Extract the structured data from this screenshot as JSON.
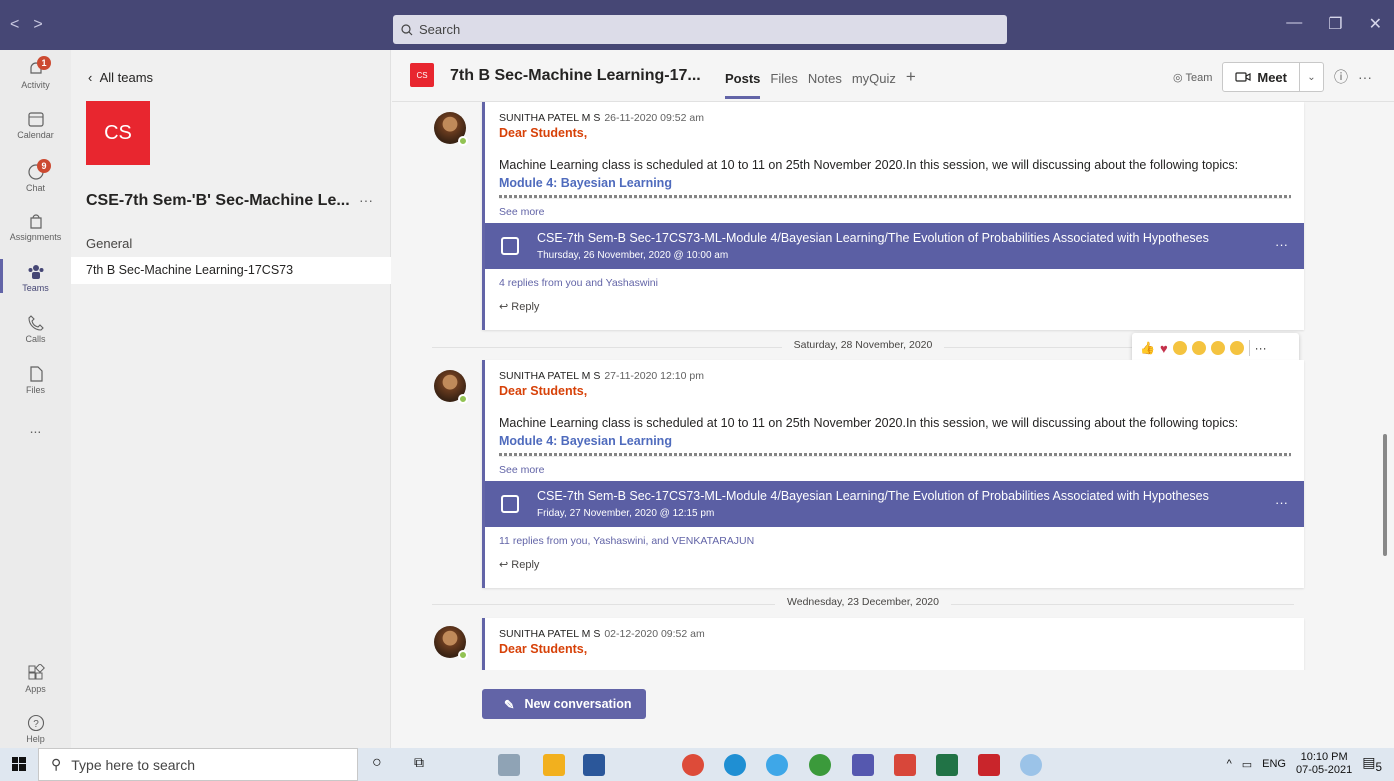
{
  "topbar": {
    "search_placeholder": "Search",
    "nav_back": "<",
    "nav_forward": ">",
    "minimize": "—",
    "maximize": "❐",
    "close": "✕"
  },
  "rail": {
    "items": [
      {
        "label": "Activity",
        "badge": "1"
      },
      {
        "label": "Calendar"
      },
      {
        "label": "Chat",
        "badge": "9"
      },
      {
        "label": "Assignments"
      },
      {
        "label": "Teams"
      },
      {
        "label": "Calls"
      },
      {
        "label": "Files"
      },
      {
        "label": "..."
      },
      {
        "label": "Apps"
      },
      {
        "label": "Help"
      }
    ]
  },
  "panel": {
    "back_label": "All teams",
    "team_logo": "CS",
    "team_name": "CSE-7th Sem-'B' Sec-Machine Le...",
    "more": "···",
    "channels": [
      "General",
      "7th B Sec-Machine Learning-17CS73"
    ]
  },
  "channel": {
    "logo": "CS",
    "title": "7th B Sec-Machine Learning-17...",
    "tabs": [
      "Posts",
      "Files",
      "Notes",
      "myQuiz",
      "+"
    ],
    "team_button": "Team",
    "meet_label": "Meet",
    "info": "ⓘ",
    "more": "···"
  },
  "posts": [
    {
      "author": "SUNITHA PATEL M S",
      "time": "26-11-2020 09:52 am",
      "greeting": "Dear Students,",
      "body": "Machine Learning class is scheduled at 10 to 11 on 25th November 2020.In this  session, we will discussing about the following topics:",
      "module": "Module 4:  Bayesian Learning",
      "see_more": "See more",
      "meeting_title": "CSE-7th Sem-B Sec-17CS73-ML-Module 4/Bayesian Learning/The Evolution of Probabilities Associated with Hypotheses",
      "meeting_date": "Thursday, 26 November, 2020 @ 10:00 am",
      "replies": "4 replies from you and Yashaswini",
      "reply_label": "Reply"
    },
    {
      "author": "SUNITHA PATEL M S",
      "time": "27-11-2020 12:10 pm",
      "greeting": "Dear Students,",
      "body": "Machine Learning class is scheduled at 10 to 11 on 25th November 2020.In this  session, we will discussing about the following topics:",
      "module": "Module 4:  Bayesian Learning",
      "see_more": "See more",
      "meeting_title": "CSE-7th Sem-B Sec-17CS73-ML-Module 4/Bayesian Learning/The Evolution of Probabilities Associated with Hypotheses",
      "meeting_date": "Friday, 27 November, 2020 @ 12:15 pm",
      "replies": "11 replies from you, Yashaswini, and VENKATARAJUN",
      "reply_label": "Reply"
    },
    {
      "author": "SUNITHA PATEL M S",
      "time": "02-12-2020 09:52 am",
      "greeting": "Dear Students,"
    }
  ],
  "date_separators": [
    "Saturday, 28 November, 2020",
    "Wednesday, 23 December, 2020"
  ],
  "reactions_more": "···",
  "new_conversation": "New conversation",
  "taskbar": {
    "search_placeholder": "Type here to search",
    "lang": "ENG",
    "time": "10:10 PM",
    "date": "07-05-2021",
    "notif": "5"
  }
}
